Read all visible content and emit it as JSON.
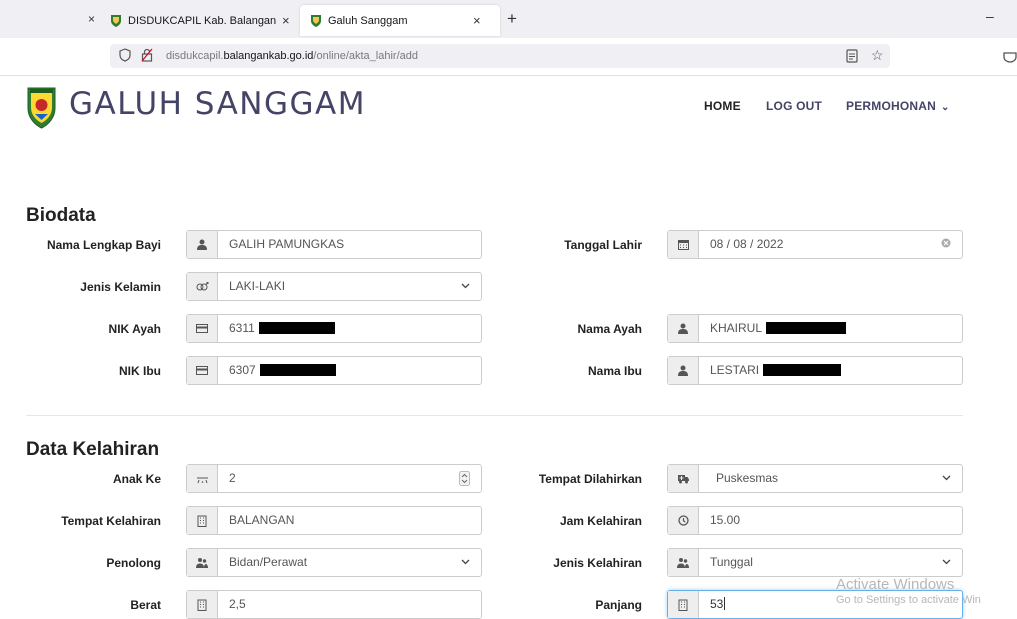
{
  "browser": {
    "tabs": [
      {
        "label": "DISDUKCAPIL Kab. Balangan"
      },
      {
        "label": "Galuh Sanggam"
      }
    ],
    "close_glyph": "×",
    "new_tab_glyph": "+",
    "minimize_glyph": "–",
    "url_prefix": "disdukcapil.",
    "url_host": "balangankab.go.id",
    "url_path": "/online/akta_lahir/add",
    "star_glyph": "☆"
  },
  "site": {
    "brand": "GALUH SANGGAM",
    "nav": {
      "home": "HOME",
      "logout": "LOG OUT",
      "permohonan": "PERMOHONAN"
    },
    "chevron": "⌄"
  },
  "biodata": {
    "title": "Biodata",
    "nama_bayi": {
      "label": "Nama Lengkap Bayi",
      "value": "GALIH PAMUNGKAS"
    },
    "tanggal_lahir": {
      "label": "Tanggal Lahir",
      "value": "08 / 08 / 2022"
    },
    "jenis_kelamin": {
      "label": "Jenis Kelamin",
      "value": "LAKI-LAKI"
    },
    "nik_ayah": {
      "label": "NIK Ayah",
      "value": "6311"
    },
    "nama_ayah": {
      "label": "Nama Ayah",
      "value": "KHAIRUL"
    },
    "nik_ibu": {
      "label": "NIK Ibu",
      "value": "6307"
    },
    "nama_ibu": {
      "label": "Nama Ibu",
      "value": "LESTARI"
    }
  },
  "kelahiran": {
    "title": "Data Kelahiran",
    "anak_ke": {
      "label": "Anak Ke",
      "value": "2"
    },
    "tempat_dilahirkan": {
      "label": "Tempat Dilahirkan",
      "value": "Puskesmas"
    },
    "tempat_kelahiran": {
      "label": "Tempat Kelahiran",
      "value": "BALANGAN"
    },
    "jam_kelahiran": {
      "label": "Jam Kelahiran",
      "value": "15.00"
    },
    "penolong": {
      "label": "Penolong",
      "value": "Bidan/Perawat"
    },
    "jenis_kelahiran": {
      "label": "Jenis Kelahiran",
      "value": "Tunggal"
    },
    "berat": {
      "label": "Berat",
      "value": "2,5"
    },
    "panjang": {
      "label": "Panjang",
      "value": "53"
    }
  },
  "watermark": {
    "line1": "Activate Windows",
    "line2": "Go to Settings to activate Win"
  },
  "icons": {
    "user": "user-icon",
    "calendar": "calendar-icon",
    "gender": "gender-icon",
    "card": "id-card-icon",
    "clock": "clock-icon",
    "building": "building-icon",
    "ambulance": "ambulance-icon",
    "users": "user-group-icon",
    "cradle": "cradle-icon"
  }
}
